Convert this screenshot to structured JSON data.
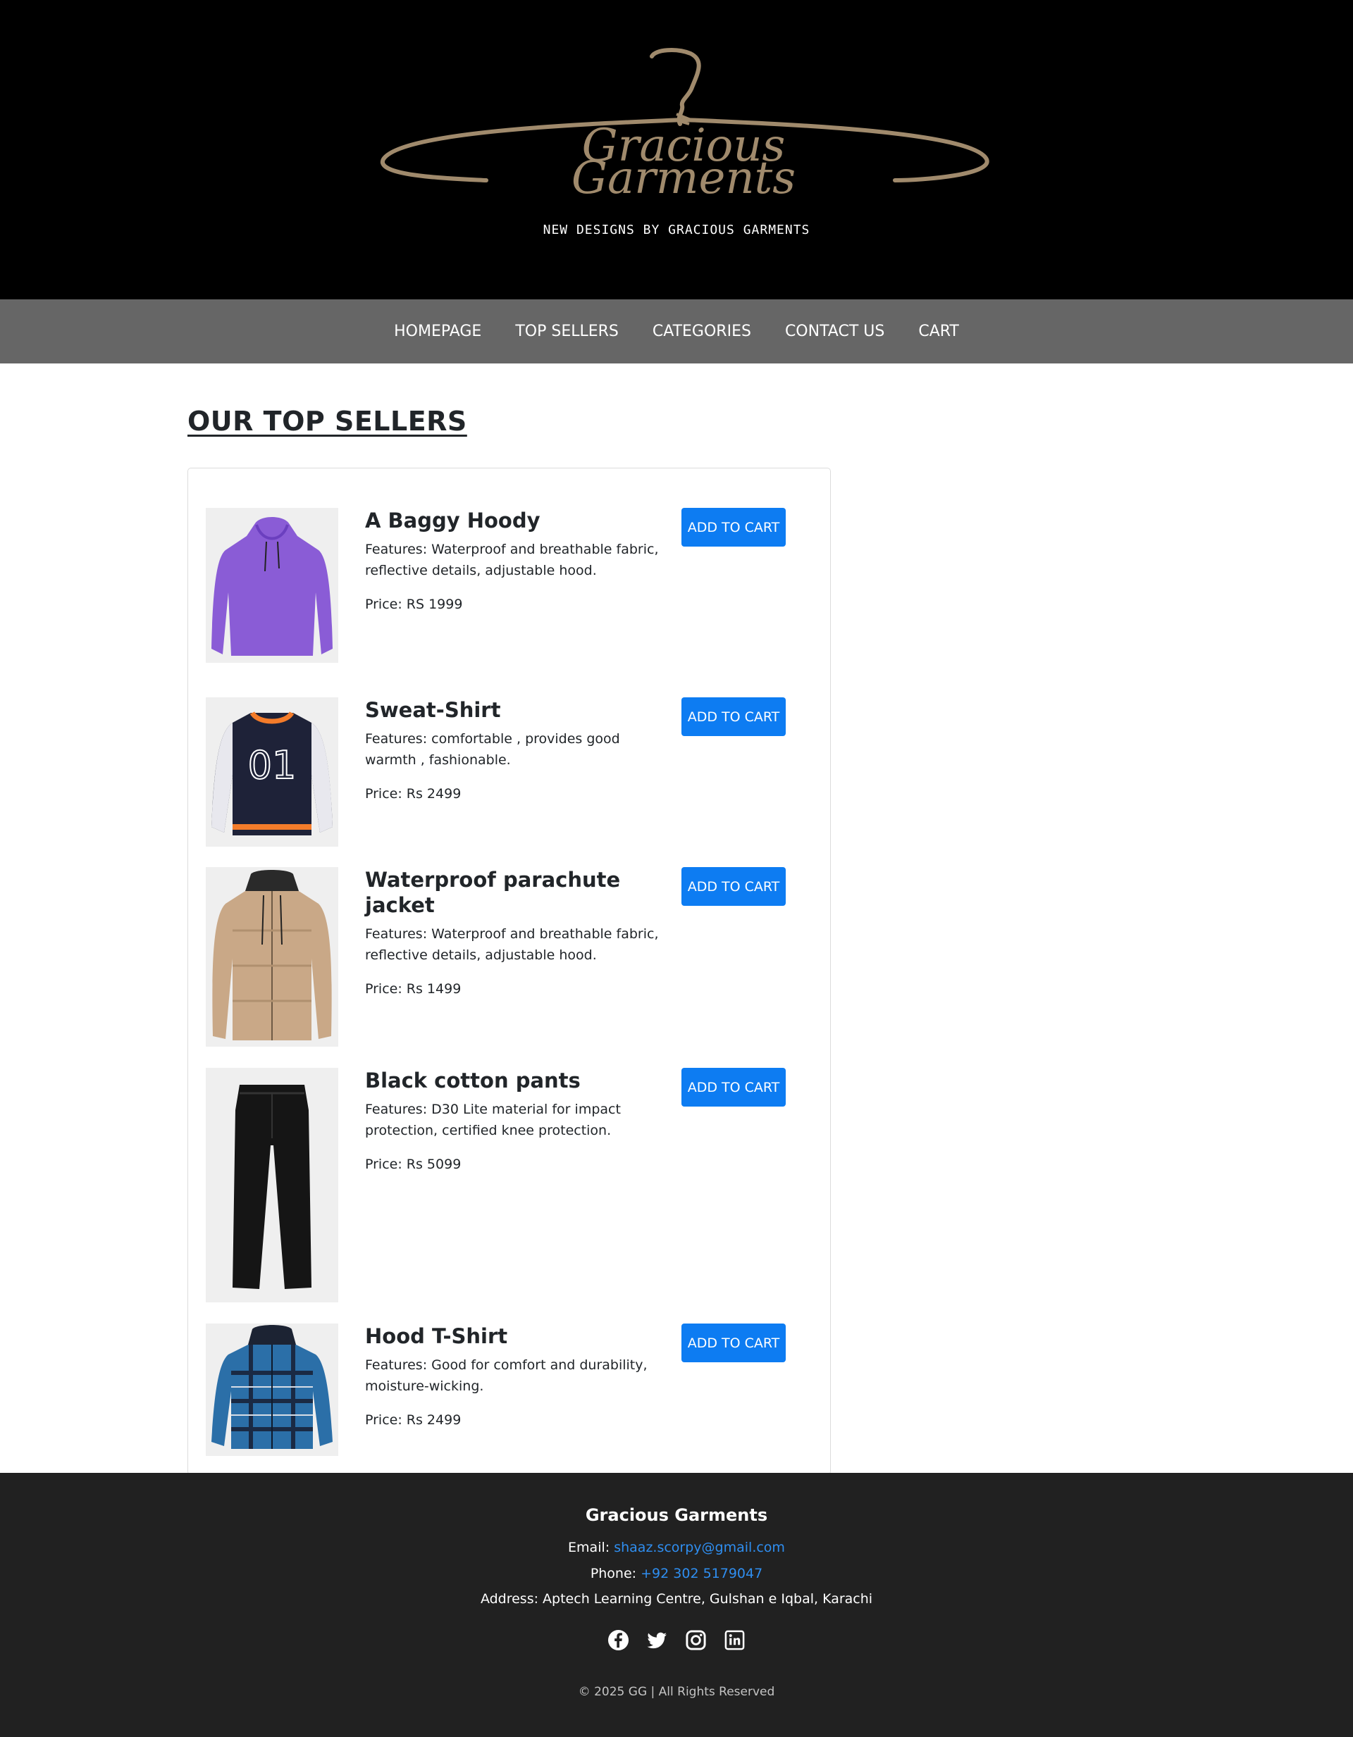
{
  "brand": {
    "logo_line1": "Gracious",
    "logo_line2": "Garments",
    "tagline": "NEW DESIGNS BY GRACIOUS GARMENTS",
    "logo_color": "#a08a6c"
  },
  "nav": {
    "items": [
      {
        "label": "HOMEPAGE"
      },
      {
        "label": "TOP SELLERS"
      },
      {
        "label": "CATEGORIES"
      },
      {
        "label": "CONTACT US"
      },
      {
        "label": "CART"
      }
    ]
  },
  "main": {
    "title": "OUR TOP SELLERS",
    "products": [
      {
        "name": "A Baggy Hoody",
        "features": "Features: Waterproof and breathable fabric, reflective details, adjustable hood.",
        "price": "Price: RS 1999",
        "button": "ADD TO CART",
        "image": "hoodie-icon"
      },
      {
        "name": "Sweat-Shirt",
        "features": "Features: comfortable , provides good warmth , fashionable.",
        "price": "Price: Rs 2499",
        "button": "ADD TO CART",
        "image": "sweatshirt-icon"
      },
      {
        "name": "Waterproof parachute jacket",
        "features": "Features: Waterproof and breathable fabric, reflective details, adjustable hood.",
        "price": "Price: Rs 1499",
        "button": "ADD TO CART",
        "image": "jacket-icon"
      },
      {
        "name": "Black cotton pants",
        "features": "Features: D30 Lite material for impact protection, certified knee protection.",
        "price": "Price: Rs 5099",
        "button": "ADD TO CART",
        "image": "pants-icon"
      },
      {
        "name": "Hood T-Shirt",
        "features": "Features: Good for comfort and durability, moisture-wicking.",
        "price": "Price: Rs 2499",
        "button": "ADD TO CART",
        "image": "flannel-shirt-icon"
      }
    ],
    "button_color": "#0d7cf2"
  },
  "footer": {
    "brand": "Gracious Garments",
    "email_label": "Email:",
    "email": "shaaz.scorpy@gmail.com",
    "phone_label": "Phone:",
    "phone": "+92 302 5179047",
    "address": "Address: Aptech Learning Centre, Gulshan e Iqbal, Karachi",
    "social": [
      "facebook-icon",
      "twitter-icon",
      "instagram-icon",
      "linkedin-icon"
    ],
    "copyright": "© 2025 GG | All Rights Reserved",
    "link_color": "#2f8ef0"
  }
}
